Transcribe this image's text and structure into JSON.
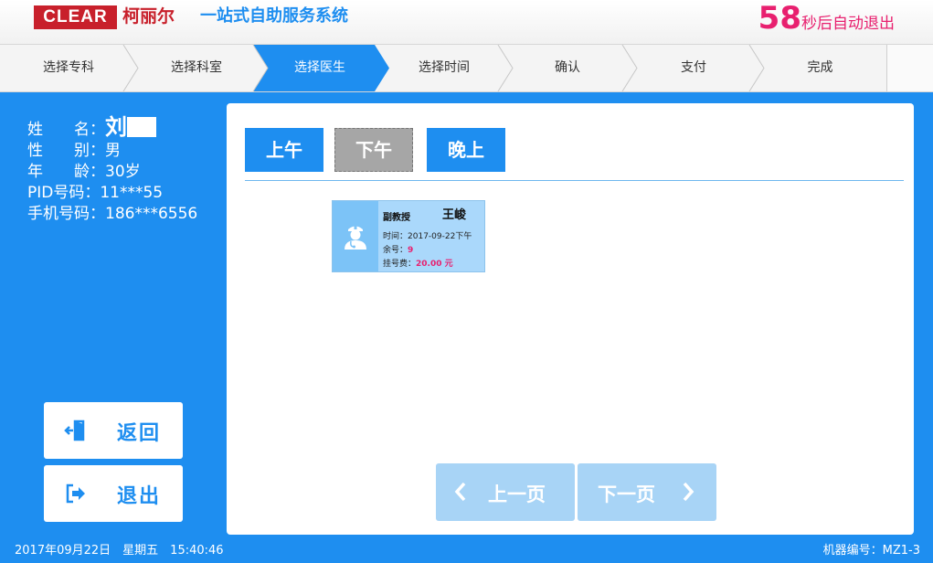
{
  "header": {
    "logo_text": "CLEAR",
    "brand_cn": "柯丽尔",
    "system_title": "一站式自助服务系统",
    "countdown_number": "58",
    "countdown_text": "秒后自动退出"
  },
  "steps": [
    {
      "label": "选择专科",
      "active": false
    },
    {
      "label": "选择科室",
      "active": false
    },
    {
      "label": "选择医生",
      "active": true
    },
    {
      "label": "选择时间",
      "active": false
    },
    {
      "label": "确认",
      "active": false
    },
    {
      "label": "支付",
      "active": false
    },
    {
      "label": "完成",
      "active": false
    }
  ],
  "patient": {
    "name_label": "姓　　名：",
    "name_value": "刘",
    "gender_label": "性　　别：",
    "gender_value": "男",
    "age_label": "年　　龄：",
    "age_value": "30岁",
    "pid_label": "PID号码：",
    "pid_value": "11***55",
    "phone_label": "手机号码：",
    "phone_value": "186***6556"
  },
  "side_buttons": {
    "back_label": "返回",
    "exit_label": "退出"
  },
  "footer": {
    "datetime": "2017年09月22日　星期五　15:40:46",
    "machine_label": "机器编号：MZ1-3"
  },
  "tabs": [
    {
      "label": "上午",
      "selected": true
    },
    {
      "label": "下午",
      "selected": false
    },
    {
      "label": "晚上",
      "selected": true
    }
  ],
  "doctor": {
    "title": "副教授",
    "name": "王峻",
    "time_label": "时间：",
    "time_value": "2017-09-22下午",
    "remaining_label": "余号：",
    "remaining_value": "9",
    "fee_label": "挂号费：",
    "fee_value": "20.00 元"
  },
  "pager": {
    "prev_label": "上一页",
    "next_label": "下一页"
  },
  "colors": {
    "primary_blue": "#1e8ef0",
    "brand_red": "#c8202b",
    "accent_pink": "#e8206f",
    "disabled_blue": "#a8d4f6",
    "tab_inactive": "#a6a6a6"
  }
}
